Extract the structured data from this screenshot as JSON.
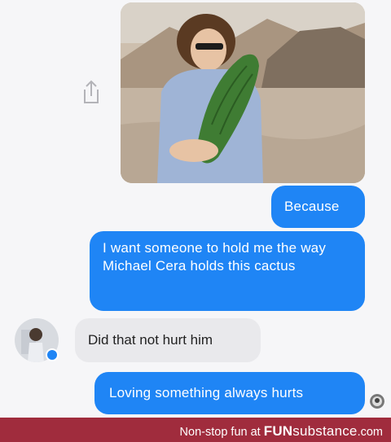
{
  "conversation": {
    "messages": [
      {
        "side": "outgoing",
        "type": "image",
        "content_icon": "photo-of-man-holding-cactus"
      },
      {
        "side": "outgoing",
        "type": "text",
        "text": "Because"
      },
      {
        "side": "outgoing",
        "type": "text",
        "text": "I want someone to hold me the way Michael Cera holds this cactus"
      },
      {
        "side": "incoming",
        "type": "text",
        "text": "Did that not hurt him"
      },
      {
        "side": "outgoing",
        "type": "text",
        "text": "Loving something always hurts"
      }
    ]
  },
  "icons": {
    "share": "share-icon",
    "avatar": "contact-avatar",
    "messenger_badge": "messenger-badge-icon",
    "read_receipt": "read-receipt-avatar"
  },
  "footer": {
    "prefix": "Non-stop fun at",
    "brand_bold": "FUN",
    "brand_rest": "substance",
    "suffix": ".com"
  },
  "colors": {
    "outgoing_bubble": "#1f85f5",
    "incoming_bubble": "#e9e9ec",
    "background": "#f6f6f8",
    "footer_bar": "#a02c3d"
  }
}
